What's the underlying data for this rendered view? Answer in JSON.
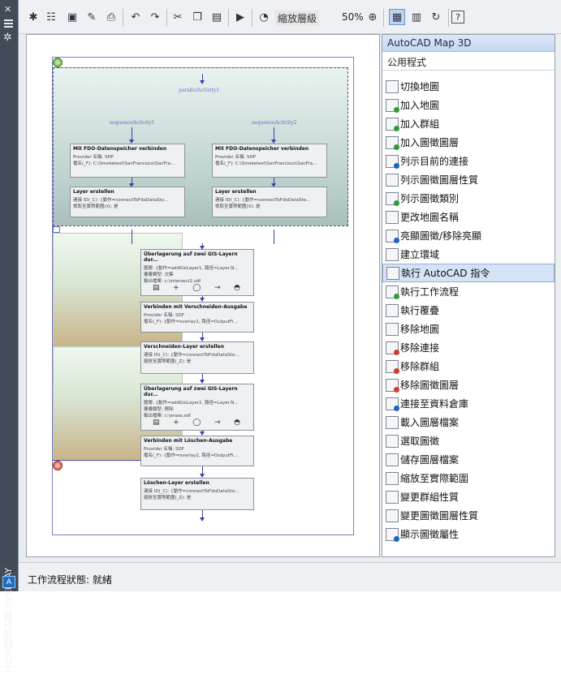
{
  "sidebar": {
    "title": "工作流程設計器 OVERLAY",
    "logo": "A"
  },
  "toolbar": {
    "zoom_label": "縮放層級",
    "zoom_value": "50%",
    "icons": [
      "new-workflow-icon",
      "new-from-template-icon",
      "save-icon",
      "save-as-icon",
      "print-icon",
      "undo-icon",
      "redo-icon",
      "cut-icon",
      "copy-icon",
      "paste-icon",
      "run-workflow-icon",
      "zoom-icon",
      "zoom-fit-icon",
      "designer-view-icon",
      "xml-view-icon",
      "refresh-icon",
      "help-icon"
    ]
  },
  "palette": {
    "title": "AutoCAD Map 3D",
    "category": "公用程式",
    "selected_index": 10,
    "items": [
      {
        "label": "切換地圖",
        "icon": "switch-map-icon",
        "color": ""
      },
      {
        "label": "加入地圖",
        "icon": "add-map-icon",
        "color": "#2e9b3a"
      },
      {
        "label": "加入群組",
        "icon": "add-group-icon",
        "color": "#2e9b3a"
      },
      {
        "label": "加入圖徵圖層",
        "icon": "add-layer-icon",
        "color": "#2e9b3a"
      },
      {
        "label": "列示目前的連接",
        "icon": "list-connections-icon",
        "color": "#1e62c8"
      },
      {
        "label": "列示圖徵圖層性質",
        "icon": "list-layer-props-icon",
        "color": ""
      },
      {
        "label": "列示圖徵類別",
        "icon": "list-feature-class-icon",
        "color": "#2e9b3a"
      },
      {
        "label": "更改地圖名稱",
        "icon": "rename-map-icon",
        "color": ""
      },
      {
        "label": "亮顯圖徵/移除亮顯",
        "icon": "highlight-icon",
        "color": "#1e62c8"
      },
      {
        "label": "建立環域",
        "icon": "buffer-icon",
        "color": ""
      },
      {
        "label": "執行 AutoCAD 指令",
        "icon": "run-command-icon",
        "color": ""
      },
      {
        "label": "執行工作流程",
        "icon": "run-workflow-icon",
        "color": "#2e9b3a"
      },
      {
        "label": "執行覆疊",
        "icon": "overlay-icon",
        "color": ""
      },
      {
        "label": "移除地圖",
        "icon": "remove-map-icon",
        "color": ""
      },
      {
        "label": "移除連接",
        "icon": "remove-connection-icon",
        "color": "#d43a2a"
      },
      {
        "label": "移除群組",
        "icon": "remove-group-icon",
        "color": "#d43a2a"
      },
      {
        "label": "移除圖徵圖層",
        "icon": "remove-layer-icon",
        "color": "#d43a2a"
      },
      {
        "label": "連接至資料倉庫",
        "icon": "connect-store-icon",
        "color": "#1e62c8"
      },
      {
        "label": "載入圖層檔案",
        "icon": "load-layer-file-icon",
        "color": ""
      },
      {
        "label": "選取圖徵",
        "icon": "select-features-icon",
        "color": ""
      },
      {
        "label": "儲存圖層檔案",
        "icon": "save-layer-file-icon",
        "color": ""
      },
      {
        "label": "縮放至實際範圍",
        "icon": "zoom-extents-icon",
        "color": ""
      },
      {
        "label": "變更群組性質",
        "icon": "change-group-props-icon",
        "color": ""
      },
      {
        "label": "變更圖徵圖層性質",
        "icon": "change-layer-props-icon",
        "color": ""
      },
      {
        "label": "顯示圖徵屬性",
        "icon": "show-attributes-icon",
        "color": "#1e62c8"
      }
    ]
  },
  "workflow": {
    "parallel_label": "parallelActivity1",
    "branches": [
      {
        "seq_label": "sequenceActivity1",
        "connect": {
          "title": "Mit FDO-Datenspeicher verbinden",
          "rows": [
            "Provider 名稱: SHP",
            "檔名(_F): C:\\Smoketest\\SanFrancisco\\SanFra..."
          ]
        },
        "layer": {
          "title": "Layer erstellen",
          "rows": [
            "連接 ID(_C): {動作=connectToFdoDataSto...",
            "檢取至實際範圍(X): 是"
          ]
        }
      },
      {
        "seq_label": "sequenceActivity2",
        "connect": {
          "title": "Mit FDO-Datenspeicher verbinden",
          "rows": [
            "Provider 名稱: SHP",
            "檔名(_F): C:\\Smoketest\\SanFrancisco\\SanFra..."
          ]
        },
        "layer": {
          "title": "Layer erstellen",
          "rows": [
            "連接 ID(_C): {動作=connectToFdoDataSto...",
            "檢取至實際範圍(X): 是"
          ]
        }
      }
    ],
    "steps": [
      {
        "title": "Überlagerung auf zwei GIS-Layern dur...",
        "rows": [
          "圖層: {動作=addGisLayer1, 路徑=Layer.N...",
          "覆疊類型: 交集",
          "輸出檔案: c:\\intersect2.sdf"
        ],
        "diagram": true
      },
      {
        "title": "Verbinden mit Verschneiden-Ausgabe",
        "rows": [
          "Provider 名稱: SDF",
          "檔名(_F): {動作=overlay1, 路徑=OutputFi..."
        ]
      },
      {
        "title": "Verschneiden-Layer erstellen",
        "rows": [
          "連接 ID(_C): {動作=connectToFdoDataSto...",
          "縮放至實際範圍(_Z): 是"
        ]
      },
      {
        "title": "Überlagerung auf zwei GIS-Layern dur...",
        "rows": [
          "圖層: {動作=addGisLayer2, 路徑=Layer.N...",
          "覆疊類型: 擦除",
          "輸出檔案: c:\\erase.sdf"
        ],
        "diagram": true
      },
      {
        "title": "Verbinden mit Löschen-Ausgabe",
        "rows": [
          "Provider 名稱: SDF",
          "檔名(_F): {動作=overlay2, 路徑=OutputFi..."
        ]
      },
      {
        "title": "Löschen-Layer erstellen",
        "rows": [
          "連接 ID(_C): {動作=connectToFdoDataSto...",
          "縮放至實際範圍(_Z): 是"
        ]
      }
    ]
  },
  "status": {
    "label": "工作流程狀態: 就緒"
  }
}
